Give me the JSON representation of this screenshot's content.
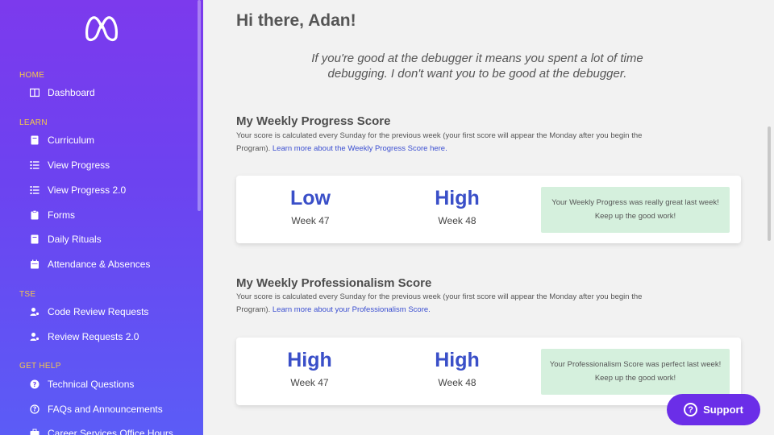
{
  "sidebar": {
    "sections": {
      "home": "HOME",
      "learn": "LEARN",
      "tse": "TSE",
      "get_help": "GET HELP"
    },
    "items": [
      {
        "label": "Dashboard",
        "icon": "book-open-icon"
      },
      {
        "label": "Curriculum",
        "icon": "book-icon"
      },
      {
        "label": "View Progress",
        "icon": "list-icon"
      },
      {
        "label": "View Progress 2.0",
        "icon": "list-icon"
      },
      {
        "label": "Forms",
        "icon": "clipboard-icon"
      },
      {
        "label": "Daily Rituals",
        "icon": "book-icon"
      },
      {
        "label": "Attendance & Absences",
        "icon": "calendar-icon"
      },
      {
        "label": "Code Review Requests",
        "icon": "user-gear-icon"
      },
      {
        "label": "Review Requests 2.0",
        "icon": "user-gear-icon"
      },
      {
        "label": "Technical Questions",
        "icon": "question-circle-icon"
      },
      {
        "label": "FAQs and Announcements",
        "icon": "question-circle-icon"
      },
      {
        "label": "Career Services Office Hours",
        "icon": "briefcase-icon"
      }
    ]
  },
  "main": {
    "greeting": "Hi there, Adan!",
    "quote_line1": "If you're good at the debugger it means you spent a lot of time",
    "quote_line2": "debugging. I don't want you to be good at the debugger.",
    "progress": {
      "title": "My Weekly Progress Score",
      "desc_line1": "Your score is calculated every Sunday for the previous week (your first score will appear the Monday after you begin the",
      "desc_prefix": "Program). ",
      "link": "Learn more about the Weekly Progress Score here.",
      "week1_level": "Low",
      "week1_label": "Week 47",
      "week2_level": "High",
      "week2_label": "Week 48",
      "note": "Your Weekly Progress was really great last week! Keep up the good work!"
    },
    "professionalism": {
      "title": "My Weekly Professionalism Score",
      "desc_line1": "Your score is calculated every Sunday for the previous week (your first score will appear the Monday after you begin the",
      "desc_prefix": "Program). ",
      "link": "Learn more about your Professionalism Score.",
      "week1_level": "High",
      "week1_label": "Week 47",
      "week2_level": "High",
      "week2_label": "Week 48",
      "note": "Your Professionalism Score was perfect last week! Keep up the good work!"
    }
  },
  "support": {
    "label": "Support",
    "icon": "question-circle-icon"
  },
  "colors": {
    "sidebar_top": "#7c3aed",
    "sidebar_bottom": "#5b5cf6",
    "section_label": "#f5c84a",
    "score_blue": "#3a4fc8",
    "note_green": "#d5f0dd",
    "support_purple": "#6b2ee8"
  }
}
